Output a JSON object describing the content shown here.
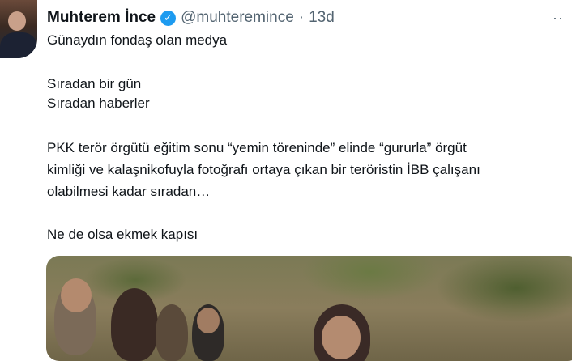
{
  "tweet": {
    "author": {
      "name": "Muhterem İnce",
      "handle": "@muhteremince",
      "separator": "·",
      "time": "13d",
      "verified_glyph": "✓"
    },
    "more_label": "··",
    "lines": [
      "Günaydın fondaş olan medya",
      "Sıradan bir gün",
      "Sıradan haberler",
      "PKK terör örgütü eğitim sonu “yemin töreninde” elinde “gururla” örgüt",
      "kimliği ve kalaşnikofuyla fotoğrafı ortaya çıkan bir teröristin İBB çalışanı",
      "olabilmesi kadar sıradan…",
      "Ne de olsa ekmek kapısı"
    ],
    "accent_color": "#1d9bf0"
  }
}
